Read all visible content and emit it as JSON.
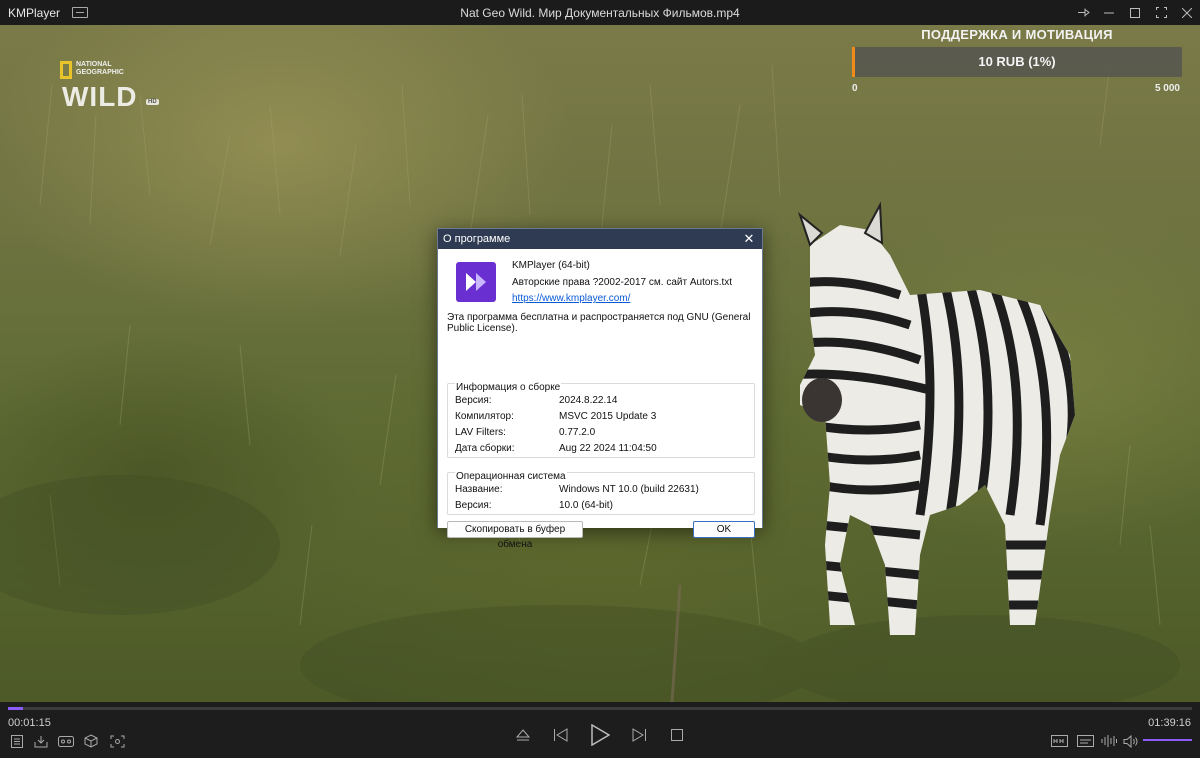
{
  "titlebar": {
    "app_name": "KMPlayer",
    "title": "Nat Geo Wild. Мир Документальных Фильмов.mp4"
  },
  "overlay": {
    "logo_small": "NATIONAL GEOGRAPHIC",
    "logo_big": "WILD",
    "logo_hd": "HD",
    "donation_title": "ПОДДЕРЖКА И МОТИВАЦИЯ",
    "donation_amount": "10 RUB (1%)",
    "donation_min": "0",
    "donation_max": "5 000",
    "donation_progress": 0.01,
    "accent_color": "#f08a1a"
  },
  "dialog": {
    "title": "О программе",
    "product": "KMPlayer (64-bit)",
    "copyright": "Авторские права ?2002-2017 см. сайт Autors.txt",
    "url": "https://www.kmplayer.com/",
    "license": "Эта программа бесплатна и распространяется под GNU (General Public License).",
    "build_group": {
      "title": "Информация о сборке",
      "rows": [
        {
          "key": "Версия:",
          "value": "2024.8.22.14"
        },
        {
          "key": "Компилятор:",
          "value": "MSVC 2015 Update 3"
        },
        {
          "key": "LAV Filters:",
          "value": "0.77.2.0"
        },
        {
          "key": "Дата сборки:",
          "value": "Aug 22 2024 11:04:50"
        }
      ]
    },
    "os_group": {
      "title": "Операционная система",
      "rows": [
        {
          "key": "Название:",
          "value": "Windows NT 10.0 (build 22631)"
        },
        {
          "key": "Версия:",
          "value": "10.0 (64-bit)"
        }
      ]
    },
    "copy_button": "Скопировать в буфер обмена",
    "ok_button": "OK"
  },
  "player": {
    "current_time": "00:01:15",
    "total_time": "01:39:16",
    "progress": 0.0126,
    "accent_color": "#8b5cf6"
  }
}
